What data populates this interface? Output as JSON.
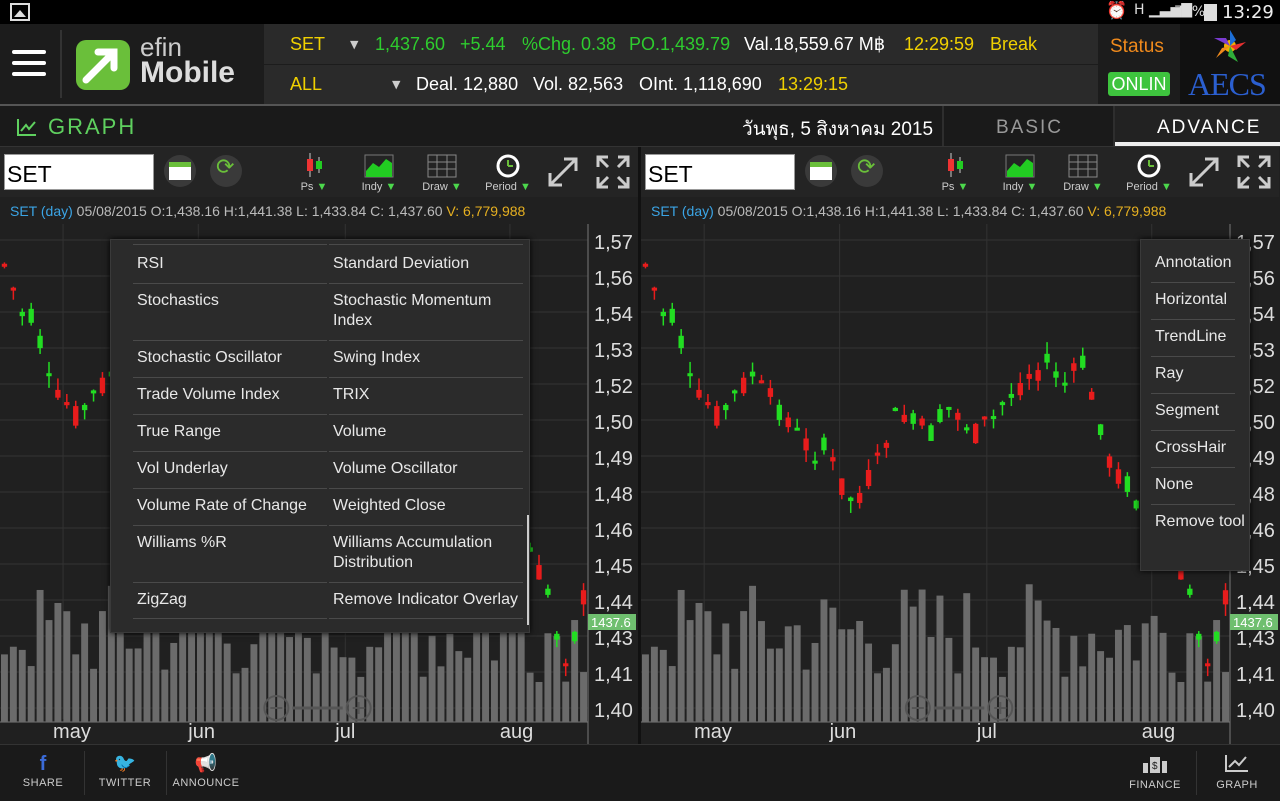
{
  "statusbar": {
    "battery": "70%",
    "time": "13:29"
  },
  "header": {
    "logo_line1": "efin",
    "logo_line2": "Mobile",
    "market": "SET",
    "index": "1,437.60",
    "change": "+5.44",
    "pct_change": "%Chg. 0.38",
    "po": "PO.1,439.79",
    "value": "Val.18,559.67 M฿",
    "time1": "12:29:59",
    "session": "Break",
    "board": "ALL",
    "deal": "Deal. 12,880",
    "volume": "Vol. 82,563",
    "oint": "OInt. 1,118,690",
    "time2": "13:29:15",
    "status_label": "Status",
    "status_value": "ONLIN",
    "broker_logo": "AECS"
  },
  "graphbar": {
    "title": "GRAPH",
    "date": "วันพุธ, 5 สิงหาคม 2015",
    "tab_basic": "BASIC",
    "tab_advance": "ADVANCE"
  },
  "left_panel": {
    "symbol": "SET",
    "tools": {
      "ps": "Ps",
      "indy": "Indy",
      "draw": "Draw",
      "period": "Period"
    },
    "ohlc_prefix": "SET",
    "ohlc_period": "(day)",
    "ohlc_values": "05/08/2015 O:1,438.16 H:1,441.38 L: 1,433.84 C: 1,437.60",
    "ohlc_volume": "V: 6,779,988",
    "indicator_menu": [
      [
        "RSI",
        "Standard Deviation"
      ],
      [
        "Stochastics",
        "Stochastic Momentum Index"
      ],
      [
        "Stochastic Oscillator",
        "Swing Index"
      ],
      [
        "Trade Volume Index",
        "TRIX"
      ],
      [
        "True Range",
        "Volume"
      ],
      [
        "Vol Underlay",
        "Volume Oscillator"
      ],
      [
        "Volume Rate of Change",
        "Weighted Close"
      ],
      [
        "Williams %R",
        "Williams Accumulation Distribution"
      ],
      [
        "ZigZag",
        "Remove Indicator Overlay"
      ]
    ]
  },
  "right_panel": {
    "symbol": "SET",
    "tools": {
      "ps": "Ps",
      "indy": "Indy",
      "draw": "Draw",
      "period": "Period"
    },
    "ohlc_prefix": "SET",
    "ohlc_period": "(day)",
    "ohlc_values": "05/08/2015 O:1,438.16 H:1,441.38 L: 1,433.84 C: 1,437.60",
    "ohlc_volume": "V: 6,779,988",
    "draw_menu": [
      "Annotation",
      "Horizontal",
      "TrendLine",
      "Ray",
      "Segment",
      "CrossHair",
      "None",
      "Remove tool"
    ]
  },
  "chart_data": {
    "type": "candlestick",
    "y_ticks": [
      "1,57",
      "1,56",
      "1,54",
      "1,53",
      "1,52",
      "1,50",
      "1,49",
      "1,48",
      "1,46",
      "1,45",
      "1,44",
      "1,43",
      "1,41",
      "1,40"
    ],
    "x_labels": [
      "may",
      "jun",
      "jul",
      "aug"
    ],
    "last_price_label": "1437.6",
    "colors": {
      "up": "#22dd22",
      "down": "#e81c1c",
      "volume": "#6b6b6b",
      "last_price": "#6fbf6f"
    }
  },
  "bottombar": {
    "share": "SHARE",
    "twitter": "TWITTER",
    "announce": "ANNOUNCE",
    "finance": "FINANCE",
    "graph": "GRAPH"
  }
}
